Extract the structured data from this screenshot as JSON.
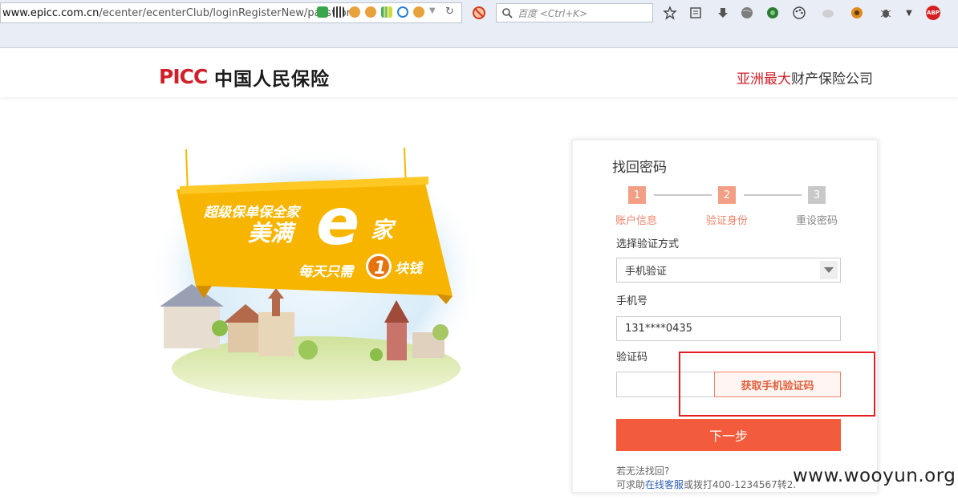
{
  "browser": {
    "url_host": "www.epicc.com.cn",
    "url_path": "/ecenter/ecenterClub/loginRegisterNew/password",
    "search_placeholder": "百度 <Ctrl+K>",
    "abp_label": "ABP"
  },
  "header": {
    "logo_en": "PICC",
    "logo_cn": "中国人民保险",
    "slogan_highlight": "亚洲最大",
    "slogan_rest": "财产保险公司"
  },
  "banner": {
    "line1": "超级保单保全家",
    "line2": "美满",
    "big_letter": "e",
    "line2_suffix": "家",
    "line3_prefix": "每天只需",
    "line3_number": "1",
    "line3_suffix": "块钱"
  },
  "form": {
    "title": "找回密码",
    "steps": [
      {
        "number": "1",
        "label": "账户信息",
        "state": "active"
      },
      {
        "number": "2",
        "label": "验证身份",
        "state": "active"
      },
      {
        "number": "3",
        "label": "重设密码",
        "state": "inactive"
      }
    ],
    "method_label": "选择验证方式",
    "method_value": "手机验证",
    "phone_label": "手机号",
    "phone_value": "131****0435",
    "code_label": "验证码",
    "code_value": "",
    "get_code_button": "获取手机验证码",
    "next_button": "下一步",
    "help_line1": "若无法找回?",
    "help_prefix": "可求助",
    "help_link": "在线客服",
    "help_suffix": "或拨打400-1234567转2."
  },
  "watermark": "www.wooyun.org",
  "colors": {
    "brand_red": "#d0202a",
    "step_active": "#f39f86",
    "primary_button": "#f25b3c",
    "highlight_box": "#e41e24"
  }
}
